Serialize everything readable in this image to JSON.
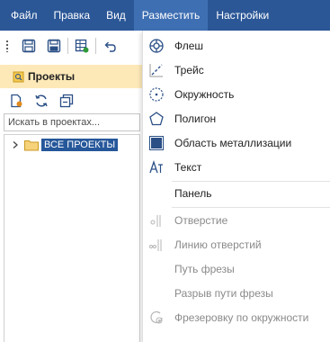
{
  "menubar": {
    "items": [
      {
        "label": "Файл"
      },
      {
        "label": "Правка"
      },
      {
        "label": "Вид"
      },
      {
        "label": "Разместить"
      },
      {
        "label": "Настройки"
      }
    ]
  },
  "toolbar": {
    "icons": [
      "save-icon",
      "save-all-icon",
      "board-icon",
      "undo-icon"
    ]
  },
  "projects_panel": {
    "title": "Проекты",
    "search_placeholder": "Искать в проектах...",
    "tree": {
      "root_label": "ВСЕ ПРОЕКТЫ"
    }
  },
  "place_menu": {
    "items": [
      {
        "label": "Флеш",
        "icon": "flash-icon",
        "enabled": true
      },
      {
        "label": "Трейс",
        "icon": "trace-icon",
        "enabled": true
      },
      {
        "label": "Окружность",
        "icon": "circle-icon",
        "enabled": true
      },
      {
        "label": "Полигон",
        "icon": "polygon-icon",
        "enabled": true
      },
      {
        "label": "Область металлизации",
        "icon": "metal-area-icon",
        "enabled": true
      },
      {
        "label": "Текст",
        "icon": "text-icon",
        "enabled": true
      },
      {
        "label": "Панель",
        "icon": "",
        "enabled": true
      },
      {
        "label": "Отверстие",
        "icon": "hole-icon",
        "enabled": false
      },
      {
        "label": "Линию отверстий",
        "icon": "hole-line-icon",
        "enabled": false
      },
      {
        "label": "Путь фрезы",
        "icon": "",
        "enabled": false
      },
      {
        "label": "Разрыв пути фрезы",
        "icon": "",
        "enabled": false
      },
      {
        "label": "Фрезеровку по окружности",
        "icon": "circular-milling-icon",
        "enabled": false
      }
    ]
  },
  "colors": {
    "menubar_bg": "#2b5797",
    "menu_active_bg": "#3f6fb3",
    "panel_header_bg": "#fde9b8",
    "tree_selected_bg": "#26579a",
    "icon_blue": "#2a4f86",
    "disabled_text": "#8a8a8a"
  }
}
